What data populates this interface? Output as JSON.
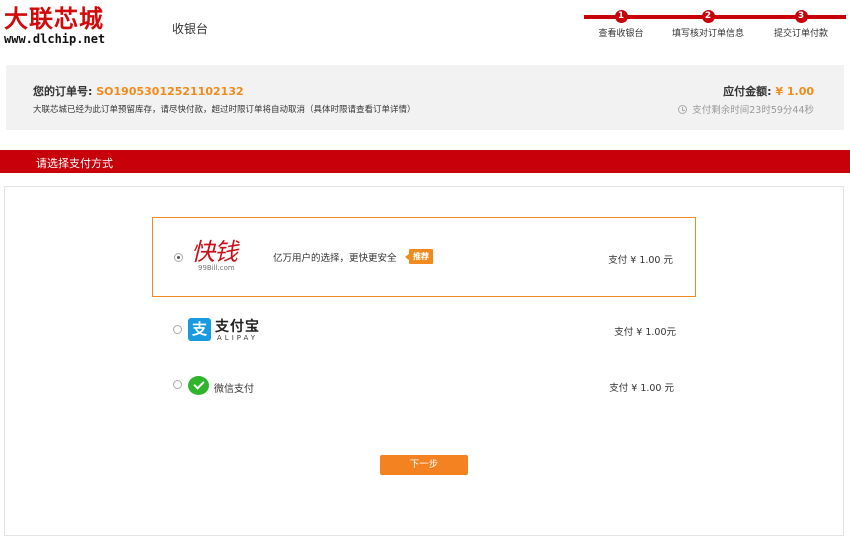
{
  "header": {
    "logo_cn": "大联芯城",
    "logo_url": "www.dlchip.net",
    "title": "收银台"
  },
  "steps": [
    {
      "num": "1",
      "label": "查看收银台"
    },
    {
      "num": "2",
      "label": "填写核对订单信息"
    },
    {
      "num": "3",
      "label": "提交订单付款"
    }
  ],
  "order": {
    "no_label": "您的订单号:",
    "no_value": "SO19053012521102132",
    "note": "大联芯城已经为此订单预留库存，请尽快付款，超过时限订单将自动取消（具体时限请查看订单详情）",
    "amount_label": "应付金额:",
    "amount_value": "¥ 1.00",
    "timer": "支付剩余时间23时59分44秒"
  },
  "section": {
    "title": "请选择支付方式"
  },
  "payments": {
    "quick": {
      "logo_text": "快钱",
      "logo_sub": "99Bill.com",
      "desc": "亿万用户的选择，更快更安全",
      "badge": "推荐",
      "price": "支付 ¥ 1.00 元",
      "selected": true
    },
    "alipay": {
      "icon_glyph": "支",
      "name": "支付宝",
      "sub": "ALIPAY",
      "price": "支付 ¥ 1.00元"
    },
    "wechat": {
      "name": "微信支付",
      "price": "支付 ¥ 1.00 元"
    }
  },
  "next_button": "下一步",
  "colors": {
    "brand_red": "#c8000a",
    "accent_orange": "#f08a1c",
    "alipay_blue": "#1a9ae0",
    "wechat_green": "#30b32d"
  }
}
